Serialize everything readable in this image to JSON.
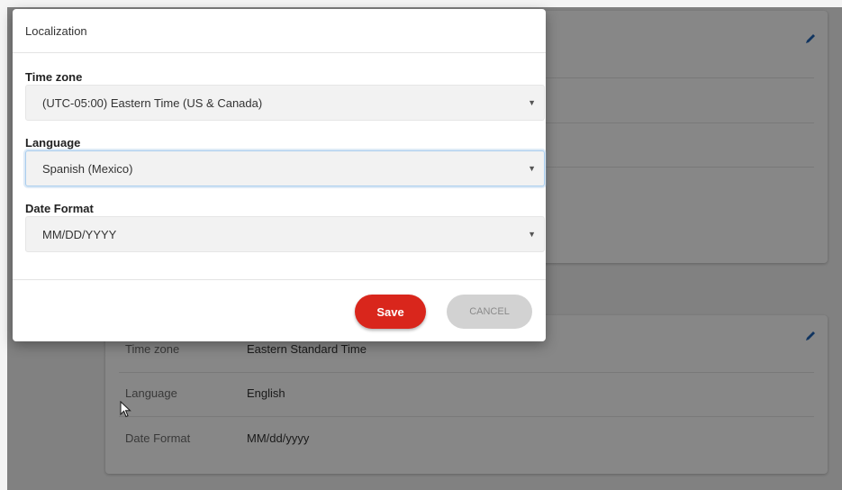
{
  "background": {
    "summary_card": {
      "rows": [
        {
          "label": "Time zone",
          "value": "Eastern Standard Time"
        },
        {
          "label": "Language",
          "value": "English"
        },
        {
          "label": "Date Format",
          "value": "MM/dd/yyyy"
        }
      ],
      "edit_icon": "pencil-icon"
    }
  },
  "modal": {
    "title": "Localization",
    "fields": {
      "timezone": {
        "label": "Time zone",
        "value": "(UTC-05:00) Eastern Time (US & Canada)"
      },
      "language": {
        "label": "Language",
        "value": "Spanish (Mexico)"
      },
      "date_format": {
        "label": "Date Format",
        "value": "MM/DD/YYYY"
      }
    },
    "save_label": "Save",
    "cancel_label": "CANCEL"
  },
  "colors": {
    "save_button": "#d9261c",
    "cancel_button": "#d2d2d2",
    "edit_icon": "#1f63b5"
  }
}
